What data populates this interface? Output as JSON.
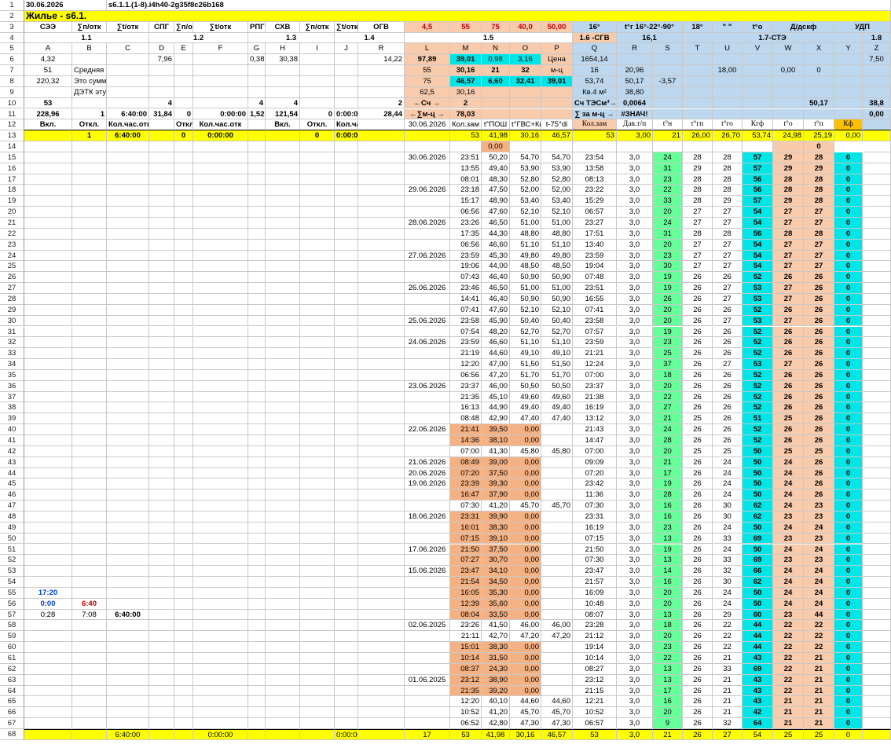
{
  "sheet": {
    "date": "30.06.2026",
    "code": "s6.1.1.(1-8).i4h40-2g35f8c26b168",
    "title": "Жилье - s6.1."
  },
  "colors": {
    "yellow": "#ffff00",
    "salmon": "#f4b183",
    "light_blue": "#bdd7ee",
    "green": "#66ff99",
    "cyan": "#00e5e5",
    "orange": "#ffc000",
    "red": "#c00000",
    "blue": "#0044cc"
  },
  "row3": [
    "СЭЭ",
    "∑п/отк",
    "∑t/отк",
    "СПГ",
    "∑п/отк",
    "∑t/отк",
    "РПГ",
    "СХВ",
    "∑п/отк",
    "∑t/отк",
    "ОГВ",
    "4,5",
    "55",
    "75",
    "40,0",
    "50,00",
    "16°",
    "t°г 16°-22°-90°",
    "18°",
    "\" \"",
    "t°o",
    "Д/дскф",
    "УДП"
  ],
  "row4": [
    "1.1",
    "1.2",
    "1.3",
    "1.4",
    "1.5",
    "1.6 -СГВ",
    "16,1",
    "1.7-СТЭ",
    "1.8"
  ],
  "col_letters": [
    "A",
    "B",
    "C",
    "D",
    "E",
    "F",
    "G",
    "H",
    "I",
    "J",
    "R",
    "L",
    "M",
    "N",
    "O",
    "P",
    "Q",
    "R",
    "S",
    "T",
    "U",
    "V",
    "W",
    "X",
    "Y",
    "Z"
  ],
  "row6": [
    "4,32",
    "",
    "",
    "7,96",
    "",
    "",
    "0,38",
    "30,38",
    "",
    "",
    "14,22",
    "97,89",
    "39,01",
    "0,98",
    "3,16",
    "Цена",
    "1654,14",
    "",
    "",
    "",
    "",
    "",
    "",
    "",
    "",
    "7,50"
  ],
  "row7": [
    "51",
    "Средняя",
    "",
    "",
    "",
    "",
    "",
    "",
    "",
    "",
    "",
    "55",
    "30,16",
    "21",
    "32",
    "м-ц",
    "16",
    "20,96",
    "",
    "",
    "18,00",
    "",
    "0,00",
    "0",
    "",
    ""
  ],
  "row8": [
    "220,32",
    "Это сумм",
    "",
    "",
    "",
    "",
    "",
    "",
    "",
    "",
    "",
    "75",
    "46,57",
    "6,60",
    "32,41",
    "39,01",
    "53,74",
    "50,17",
    "-3,57",
    "",
    "",
    "",
    "",
    "",
    "",
    ""
  ],
  "row9": [
    "",
    "ДЭТК эту",
    "",
    "",
    "",
    "",
    "",
    "",
    "",
    "",
    "",
    "62,5",
    "30,16",
    "",
    "",
    "",
    "Кв.4 м²",
    "38,80",
    "",
    "",
    "",
    "",
    "",
    "",
    "",
    ""
  ],
  "row10": [
    "53",
    "",
    "",
    "4",
    "",
    "",
    "4",
    "4",
    "",
    "",
    "2",
    "←Сч →",
    "2",
    "",
    "",
    "",
    "Сч ТЭСм³→",
    "0,0064",
    "",
    "",
    "",
    "",
    "",
    "50,17",
    "",
    "38,8"
  ],
  "row11": [
    "228,96",
    "1",
    "6:40:00",
    "31,84",
    "0",
    "0:00:00",
    "1,52",
    "121,54",
    "0",
    "0:00:00",
    "28,44",
    "←∑м-ц →",
    "78,03",
    "",
    "",
    "",
    "∑ за м-ц →",
    "#ЗНАЧ!",
    "",
    "",
    "",
    "",
    "",
    "",
    "",
    "0,00"
  ],
  "row12": [
    "Вкл.",
    "Откл.",
    "Кол.час.отк",
    "",
    "Откл.",
    "Кол.час.отк",
    "",
    "Вкл.",
    "Откл.",
    "Кол.час.отк",
    "",
    "30.06.2026",
    "Кол.зам",
    "t°ПОШ",
    "t°ГВС+Кк",
    "t-75°di",
    "Кол.зам",
    "Дав.т/п",
    "t°н",
    "t°гп",
    "t°го",
    "Кгф",
    "t°o",
    "t°п",
    "Кф",
    ""
  ],
  "row13": [
    "",
    "1",
    "6:40:00",
    "",
    "0",
    "0:00:00",
    "",
    "",
    "0",
    "0:00:00",
    "",
    "",
    "53",
    "41,98",
    "30,16",
    "46,57",
    "53",
    "3,00",
    "21",
    "26,00",
    "26,70",
    "53,74",
    "24,98",
    "25,19",
    "0,00",
    ""
  ],
  "left_notes": {
    "r55": "17:20",
    "r56a": "0:00",
    "r56b": "6:40",
    "r57a": "0:28",
    "r57b": "7:08",
    "r57c": "6:40:00"
  },
  "log_rows": [
    [
      "",
      "",
      "0,00",
      "",
      "",
      "",
      "",
      "",
      "",
      "",
      "",
      "",
      "0"
    ],
    [
      "30.06.2026",
      "23:51",
      "50,20",
      "54,70",
      "54,70",
      "23:54",
      "3,0",
      "24",
      "28",
      "28",
      "57",
      "29",
      "28",
      "0"
    ],
    [
      "",
      "13:55",
      "49,40",
      "53,90",
      "53,90",
      "13:58",
      "3,0",
      "31",
      "29",
      "28",
      "57",
      "29",
      "29",
      "0"
    ],
    [
      "",
      "08:01",
      "48,30",
      "52,80",
      "52,80",
      "08:13",
      "3,0",
      "23",
      "28",
      "28",
      "56",
      "28",
      "28",
      "0"
    ],
    [
      "29.06.2026",
      "23:18",
      "47,50",
      "52,00",
      "52,00",
      "23:22",
      "3,0",
      "22",
      "28",
      "28",
      "56",
      "28",
      "28",
      "0"
    ],
    [
      "",
      "15:17",
      "48,90",
      "53,40",
      "53,40",
      "15:29",
      "3,0",
      "33",
      "28",
      "29",
      "57",
      "29",
      "28",
      "0"
    ],
    [
      "",
      "06:56",
      "47,60",
      "52,10",
      "52,10",
      "06:57",
      "3,0",
      "20",
      "27",
      "27",
      "54",
      "27",
      "27",
      "0"
    ],
    [
      "28.06.2026",
      "23:26",
      "46,50",
      "51,00",
      "51,00",
      "23:27",
      "3,0",
      "24",
      "27",
      "27",
      "54",
      "27",
      "27",
      "0"
    ],
    [
      "",
      "17:35",
      "44,30",
      "48,80",
      "48,80",
      "17:51",
      "3,0",
      "31",
      "28",
      "28",
      "56",
      "28",
      "28",
      "0"
    ],
    [
      "",
      "06:56",
      "46,60",
      "51,10",
      "51,10",
      "13:40",
      "3,0",
      "20",
      "27",
      "27",
      "54",
      "27",
      "27",
      "0"
    ],
    [
      "27.06.2026",
      "23:59",
      "45,30",
      "49,80",
      "49,80",
      "23:59",
      "3,0",
      "23",
      "27",
      "27",
      "54",
      "27",
      "27",
      "0"
    ],
    [
      "",
      "19:06",
      "44,00",
      "48,50",
      "48,50",
      "19:04",
      "3,0",
      "30",
      "27",
      "27",
      "54",
      "27",
      "27",
      "0"
    ],
    [
      "",
      "07:43",
      "46,40",
      "50,90",
      "50,90",
      "07:48",
      "3,0",
      "19",
      "26",
      "26",
      "52",
      "26",
      "26",
      "0"
    ],
    [
      "26.06.2026",
      "23:46",
      "46,50",
      "51,00",
      "51,00",
      "23:51",
      "3,0",
      "19",
      "26",
      "27",
      "53",
      "27",
      "26",
      "0"
    ],
    [
      "",
      "14:41",
      "46,40",
      "50,90",
      "50,90",
      "16:55",
      "3,0",
      "26",
      "26",
      "27",
      "53",
      "27",
      "26",
      "0"
    ],
    [
      "",
      "07:41",
      "47,60",
      "52,10",
      "52,10",
      "07:41",
      "3,0",
      "20",
      "26",
      "26",
      "52",
      "26",
      "26",
      "0"
    ],
    [
      "25.06.2026",
      "23:58",
      "45,90",
      "50,40",
      "50,40",
      "23:58",
      "3,0",
      "20",
      "26",
      "27",
      "53",
      "27",
      "26",
      "0"
    ],
    [
      "",
      "07:54",
      "48,20",
      "52,70",
      "52,70",
      "07:57",
      "3,0",
      "19",
      "26",
      "26",
      "52",
      "26",
      "26",
      "0"
    ],
    [
      "24.06.2026",
      "23:59",
      "46,60",
      "51,10",
      "51,10",
      "23:59",
      "3,0",
      "23",
      "26",
      "26",
      "52",
      "26",
      "26",
      "0"
    ],
    [
      "",
      "21:19",
      "44,60",
      "49,10",
      "49,10",
      "21:21",
      "3,0",
      "25",
      "26",
      "26",
      "52",
      "26",
      "26",
      "0"
    ],
    [
      "",
      "12:20",
      "47,00",
      "51,50",
      "51,50",
      "12:24",
      "3,0",
      "37",
      "26",
      "27",
      "53",
      "27",
      "26",
      "0"
    ],
    [
      "",
      "06:56",
      "47,20",
      "51,70",
      "51,70",
      "07:00",
      "3,0",
      "18",
      "26",
      "26",
      "52",
      "26",
      "26",
      "0"
    ],
    [
      "23.06.2026",
      "23:37",
      "46,00",
      "50,50",
      "50,50",
      "23:37",
      "3,0",
      "20",
      "26",
      "26",
      "52",
      "26",
      "26",
      "0"
    ],
    [
      "",
      "21:35",
      "45,10",
      "49,60",
      "49,60",
      "21:38",
      "3,0",
      "22",
      "26",
      "26",
      "52",
      "26",
      "26",
      "0"
    ],
    [
      "",
      "16:13",
      "44,90",
      "49,40",
      "49,40",
      "16:19",
      "3,0",
      "27",
      "26",
      "26",
      "52",
      "26",
      "26",
      "0"
    ],
    [
      "",
      "08:48",
      "42,90",
      "47,40",
      "47,40",
      "13:12",
      "3,0",
      "21",
      "25",
      "26",
      "51",
      "25",
      "26",
      "0"
    ],
    [
      "22.06.2026",
      "21:41",
      "39,50",
      "0,00",
      "",
      "21:43",
      "3,0",
      "24",
      "26",
      "26",
      "52",
      "26",
      "26",
      "0"
    ],
    [
      "",
      "14:36",
      "38,10",
      "0,00",
      "",
      "14:47",
      "3,0",
      "28",
      "26",
      "26",
      "52",
      "26",
      "26",
      "0"
    ],
    [
      "",
      "07:00",
      "41,30",
      "45,80",
      "45,80",
      "07:00",
      "3,0",
      "20",
      "25",
      "25",
      "50",
      "25",
      "25",
      "0"
    ],
    [
      "21.06.2026",
      "08:49",
      "39,00",
      "0,00",
      "",
      "09:09",
      "3,0",
      "21",
      "26",
      "24",
      "50",
      "24",
      "26",
      "0"
    ],
    [
      "20.06.2026",
      "07:20",
      "37,50",
      "0,00",
      "",
      "07:20",
      "3,0",
      "17",
      "26",
      "24",
      "50",
      "24",
      "26",
      "0"
    ],
    [
      "19.06.2026",
      "23:39",
      "39,30",
      "0,00",
      "",
      "23:42",
      "3,0",
      "19",
      "26",
      "24",
      "50",
      "24",
      "26",
      "0"
    ],
    [
      "",
      "16:47",
      "37,90",
      "0,00",
      "",
      "11:36",
      "3,0",
      "28",
      "26",
      "24",
      "50",
      "24",
      "26",
      "0"
    ],
    [
      "",
      "07:30",
      "41,20",
      "45,70",
      "45,70",
      "07:30",
      "3,0",
      "16",
      "26",
      "30",
      "62",
      "24",
      "23",
      "0"
    ],
    [
      "18.06.2026",
      "23:31",
      "39,90",
      "0,00",
      "",
      "23:31",
      "3,0",
      "16",
      "26",
      "30",
      "62",
      "23",
      "23",
      "0"
    ],
    [
      "",
      "16:01",
      "38,30",
      "0,00",
      "",
      "16:19",
      "3,0",
      "23",
      "26",
      "24",
      "50",
      "24",
      "24",
      "0"
    ],
    [
      "",
      "07:15",
      "39,10",
      "0,00",
      "",
      "07:15",
      "3,0",
      "13",
      "26",
      "33",
      "69",
      "23",
      "23",
      "0"
    ],
    [
      "17.06.2026",
      "21:50",
      "37,50",
      "0,00",
      "",
      "21:50",
      "3,0",
      "19",
      "26",
      "24",
      "50",
      "24",
      "24",
      "0"
    ],
    [
      "",
      "07:27",
      "30,70",
      "0,00",
      "",
      "07:30",
      "3,0",
      "13",
      "26",
      "33",
      "69",
      "23",
      "23",
      "0"
    ],
    [
      "15.06.2026",
      "23:47",
      "34,10",
      "0,00",
      "",
      "23:47",
      "3,0",
      "14",
      "26",
      "32",
      "66",
      "24",
      "24",
      "0"
    ],
    [
      "",
      "21:54",
      "34,50",
      "0,00",
      "",
      "21:57",
      "3,0",
      "16",
      "26",
      "30",
      "62",
      "24",
      "24",
      "0"
    ],
    [
      "",
      "16:05",
      "35,30",
      "0,00",
      "",
      "16:09",
      "3,0",
      "20",
      "26",
      "24",
      "50",
      "24",
      "24",
      "0"
    ],
    [
      "",
      "12:39",
      "35,60",
      "0,00",
      "",
      "10:48",
      "3,0",
      "20",
      "26",
      "24",
      "50",
      "24",
      "24",
      "0"
    ],
    [
      "",
      "08:04",
      "33,50",
      "0,00",
      "",
      "08:07",
      "3,0",
      "13",
      "26",
      "29",
      "60",
      "23",
      "44",
      "0"
    ],
    [
      "02.06.2025",
      "23:26",
      "41,50",
      "46,00",
      "46,00",
      "23:28",
      "3,0",
      "18",
      "26",
      "22",
      "44",
      "22",
      "22",
      "0"
    ],
    [
      "",
      "21:11",
      "42,70",
      "47,20",
      "47,20",
      "21:12",
      "3,0",
      "20",
      "26",
      "22",
      "44",
      "22",
      "22",
      "0"
    ],
    [
      "",
      "15:01",
      "38,30",
      "0,00",
      "",
      "19:14",
      "3,0",
      "23",
      "26",
      "22",
      "44",
      "22",
      "22",
      "0"
    ],
    [
      "",
      "10:14",
      "31,50",
      "0,00",
      "",
      "10:14",
      "3,0",
      "22",
      "26",
      "21",
      "43",
      "22",
      "21",
      "0"
    ],
    [
      "",
      "08:37",
      "24,30",
      "0,00",
      "",
      "08:27",
      "3,0",
      "13",
      "26",
      "33",
      "69",
      "22",
      "21",
      "0"
    ],
    [
      "01.06.2025",
      "23:12",
      "38,90",
      "0,00",
      "",
      "23:12",
      "3,0",
      "13",
      "26",
      "21",
      "43",
      "22",
      "21",
      "0"
    ],
    [
      "",
      "21:35",
      "39,20",
      "0,00",
      "",
      "21:15",
      "3,0",
      "17",
      "26",
      "21",
      "43",
      "22",
      "21",
      "0"
    ],
    [
      "",
      "12:20",
      "40,10",
      "44,60",
      "44,60",
      "12:21",
      "3,0",
      "16",
      "26",
      "21",
      "43",
      "21",
      "21",
      "0"
    ],
    [
      "",
      "10:52",
      "41,20",
      "45,70",
      "45,70",
      "10:52",
      "3,0",
      "20",
      "26",
      "21",
      "42",
      "21",
      "21",
      "0"
    ],
    [
      "",
      "06:52",
      "42,80",
      "47,30",
      "47,30",
      "06:57",
      "3,0",
      "9",
      "26",
      "32",
      "64",
      "21",
      "21",
      "0"
    ]
  ],
  "row68": [
    "",
    "",
    "6:40:00",
    "",
    "",
    "0:00:00",
    "",
    "",
    "",
    "0:00:00",
    "",
    "17",
    "53",
    "41,98",
    "30,16",
    "46,57",
    "53",
    "3,0",
    "21",
    "26",
    "27",
    "54",
    "25",
    "25",
    "0",
    ""
  ]
}
